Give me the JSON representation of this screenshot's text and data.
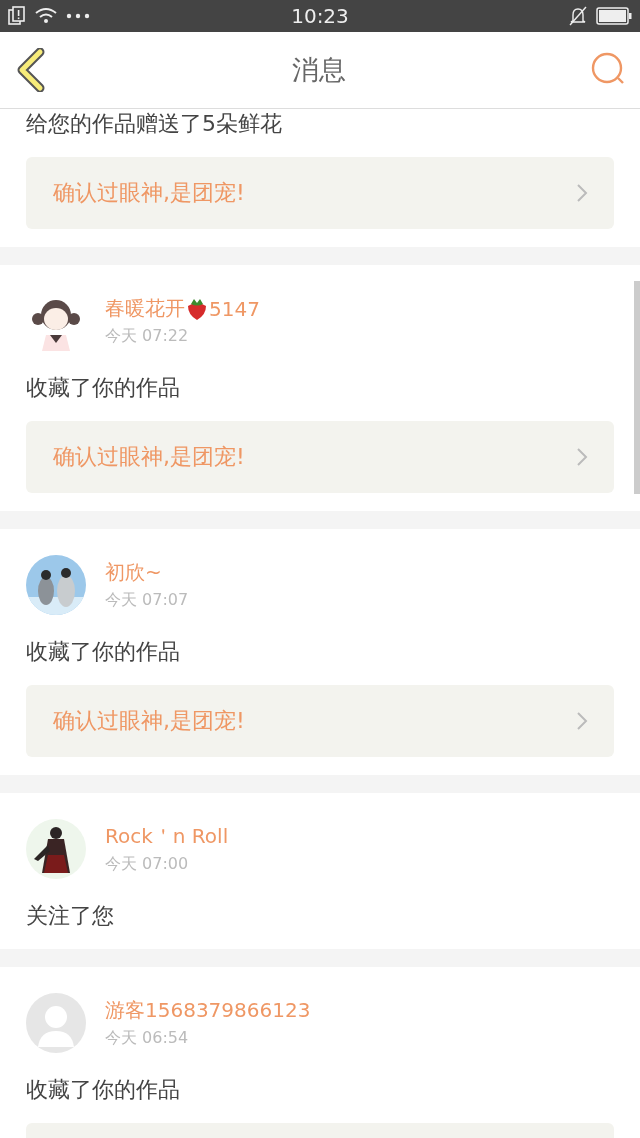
{
  "status_bar": {
    "time": "10:23"
  },
  "header": {
    "title": "消息"
  },
  "messages": [
    {
      "action": "给您的作品赠送了5朵鲜花",
      "quote": "确认过眼神,是团宠!"
    },
    {
      "user": "春暖花开",
      "badge": {
        "kind": "strawberry",
        "text": "5147"
      },
      "time": "今天 07:22",
      "action": "收藏了你的作品",
      "quote": "确认过眼神,是团宠!"
    },
    {
      "user": "初欣~",
      "time": "今天 07:07",
      "action": "收藏了你的作品",
      "quote": "确认过眼神,是团宠!"
    },
    {
      "user": "Rock＇n Roll",
      "time": "今天 07:00",
      "action": "关注了您"
    },
    {
      "avatar": {
        "kind": "placeholder"
      },
      "user": "游客1568379866123",
      "time": "今天 06:54",
      "action": "收藏了你的作品",
      "quote_cut": true
    }
  ]
}
